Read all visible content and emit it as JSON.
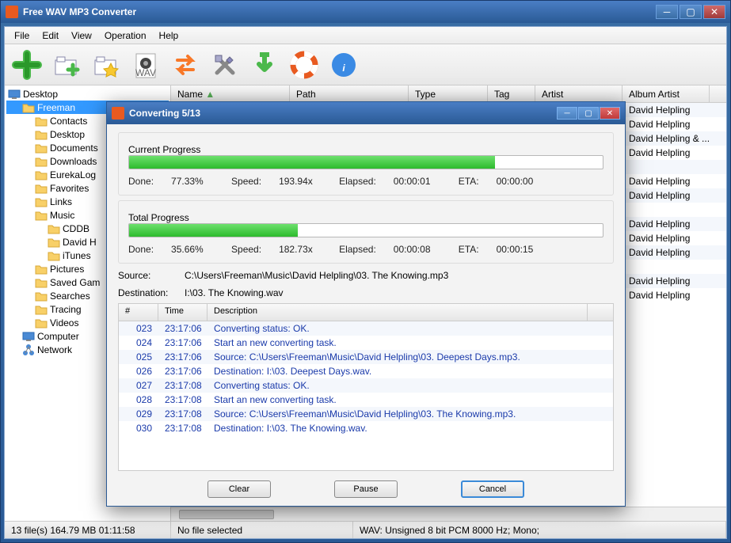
{
  "app": {
    "title": "Free WAV MP3 Converter"
  },
  "menu": [
    "File",
    "Edit",
    "View",
    "Operation",
    "Help"
  ],
  "toolbar_icons": [
    "add",
    "add-folder",
    "fav-folder",
    "doc-wav",
    "convert",
    "settings",
    "download",
    "help-ring",
    "info"
  ],
  "tree": {
    "root": "Desktop",
    "selected": "Freeman",
    "items": [
      {
        "l": 1,
        "t": "Freeman",
        "i": "user",
        "sel": true
      },
      {
        "l": 2,
        "t": "Contacts",
        "i": "folder"
      },
      {
        "l": 2,
        "t": "Desktop",
        "i": "folder"
      },
      {
        "l": 2,
        "t": "Documents",
        "i": "folder"
      },
      {
        "l": 2,
        "t": "Downloads",
        "i": "folder"
      },
      {
        "l": 2,
        "t": "EurekaLog",
        "i": "folder"
      },
      {
        "l": 2,
        "t": "Favorites",
        "i": "folder"
      },
      {
        "l": 2,
        "t": "Links",
        "i": "folder"
      },
      {
        "l": 2,
        "t": "Music",
        "i": "folder"
      },
      {
        "l": 3,
        "t": "CDDB",
        "i": "folder"
      },
      {
        "l": 3,
        "t": "David H",
        "i": "folder"
      },
      {
        "l": 3,
        "t": "iTunes",
        "i": "folder"
      },
      {
        "l": 2,
        "t": "Pictures",
        "i": "folder"
      },
      {
        "l": 2,
        "t": "Saved Gam",
        "i": "folder"
      },
      {
        "l": 2,
        "t": "Searches",
        "i": "folder"
      },
      {
        "l": 2,
        "t": "Tracing",
        "i": "folder"
      },
      {
        "l": 2,
        "t": "Videos",
        "i": "folder"
      },
      {
        "l": 1,
        "t": "Computer",
        "i": "computer"
      },
      {
        "l": 1,
        "t": "Network",
        "i": "network"
      }
    ]
  },
  "list": {
    "columns": [
      "Name",
      "Path",
      "Type",
      "Tag",
      "Artist",
      "Album Artist"
    ],
    "widths": [
      150,
      150,
      100,
      60,
      110,
      110
    ],
    "sort_col": 0,
    "rows": [
      {
        "albumartist": "David Helpling"
      },
      {
        "albumartist": "David Helpling"
      },
      {
        "albumartist": "David Helpling & ..."
      },
      {
        "albumartist": "David Helpling"
      },
      {
        "albumartist": ""
      },
      {
        "albumartist": "David Helpling"
      },
      {
        "albumartist": "David Helpling"
      },
      {
        "albumartist": ""
      },
      {
        "albumartist": "David Helpling"
      },
      {
        "albumartist": "David Helpling"
      },
      {
        "albumartist": "David Helpling"
      },
      {
        "albumartist": ""
      },
      {
        "albumartist": "David Helpling"
      },
      {
        "albumartist": "David Helpling"
      }
    ]
  },
  "status": {
    "left": "13 file(s)  164.79 MB   01:11:58",
    "mid": "No file selected",
    "right": "WAV:   Unsigned 8 bit PCM  8000 Hz;  Mono;"
  },
  "dialog": {
    "title": "Converting 5/13",
    "current": {
      "label": "Current Progress",
      "done_label": "Done:",
      "done": "77.33%",
      "pct": 77.33,
      "speed_label": "Speed:",
      "speed": "193.94x",
      "elapsed_label": "Elapsed:",
      "elapsed": "00:00:01",
      "eta_label": "ETA:",
      "eta": "00:00:00"
    },
    "total": {
      "label": "Total Progress",
      "done_label": "Done:",
      "done": "35.66%",
      "pct": 35.66,
      "speed_label": "Speed:",
      "speed": "182.73x",
      "elapsed_label": "Elapsed:",
      "elapsed": "00:00:08",
      "eta_label": "ETA:",
      "eta": "00:00:15"
    },
    "source_label": "Source:",
    "source": "C:\\Users\\Freeman\\Music\\David Helpling\\03. The Knowing.mp3",
    "dest_label": "Destination:",
    "dest": "I:\\03. The Knowing.wav",
    "log_cols": [
      "#",
      "Time",
      "Description"
    ],
    "log_widths": [
      50,
      62,
      480
    ],
    "log": [
      {
        "n": "023",
        "t": "23:17:06",
        "d": "Converting status: OK."
      },
      {
        "n": "024",
        "t": "23:17:06",
        "d": "Start an new converting task."
      },
      {
        "n": "025",
        "t": "23:17:06",
        "d": "Source:  C:\\Users\\Freeman\\Music\\David Helpling\\03. Deepest Days.mp3."
      },
      {
        "n": "026",
        "t": "23:17:06",
        "d": "Destination: I:\\03. Deepest Days.wav."
      },
      {
        "n": "027",
        "t": "23:17:08",
        "d": "Converting status: OK."
      },
      {
        "n": "028",
        "t": "23:17:08",
        "d": "Start an new converting task."
      },
      {
        "n": "029",
        "t": "23:17:08",
        "d": "Source:  C:\\Users\\Freeman\\Music\\David Helpling\\03. The Knowing.mp3."
      },
      {
        "n": "030",
        "t": "23:17:08",
        "d": "Destination: I:\\03. The Knowing.wav."
      }
    ],
    "buttons": {
      "clear": "Clear",
      "pause": "Pause",
      "cancel": "Cancel"
    }
  }
}
